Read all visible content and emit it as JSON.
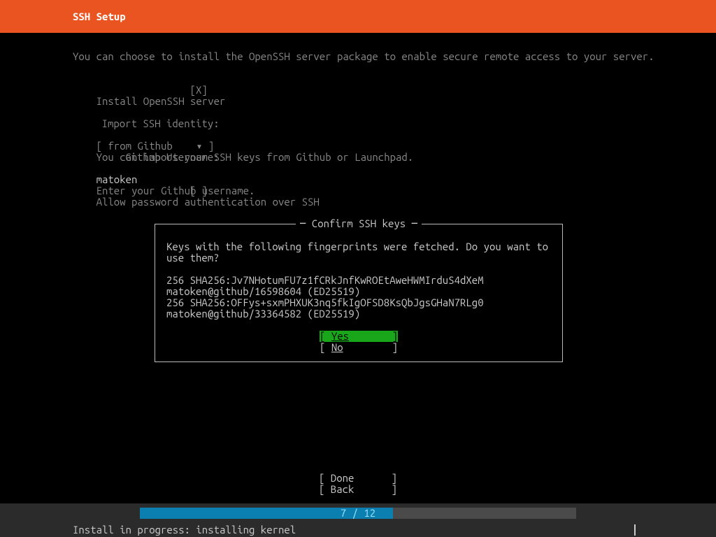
{
  "header": {
    "title": "SSH Setup"
  },
  "intro": "You can choose to install the OpenSSH server package to enable secure remote access to your server.",
  "install_openssh": {
    "checked_mark": "X",
    "label": "Install OpenSSH server"
  },
  "import_identity": {
    "label": "Import SSH identity:",
    "select_open": "[ ",
    "select_value": "from Github",
    "select_caret": "▾",
    "select_close": " ]",
    "hint": "You can import your SSH keys from Github or Launchpad."
  },
  "github_username": {
    "label": "Github Username:",
    "value": "matoken",
    "hint": "Enter your Github username."
  },
  "allow_password": {
    "checked_mark": " ",
    "label": "Allow password authentication over SSH"
  },
  "dialog": {
    "title": "Confirm SSH keys",
    "message": "Keys with the following fingerprints were fetched. Do you want to use them?",
    "lines": [
      "256 SHA256:Jv7NHotumFU7z1fCRkJnfKwROEtAweHWMIrduS4dXeM",
      "matoken@github/16598604 (ED25519)",
      "256 SHA256:OFFys+sxmPHXUK3nq5fkIgOFSD8KsQbJgsGHaN7RLg0",
      "matoken@github/33364582 (ED25519)"
    ],
    "yes": "Yes",
    "no": "No"
  },
  "nav": {
    "done": "Done",
    "back": "Back"
  },
  "progress": {
    "current": 7,
    "total": 12,
    "text": "7 / 12",
    "percent": 58
  },
  "status": "Install in progress: installing kernel"
}
